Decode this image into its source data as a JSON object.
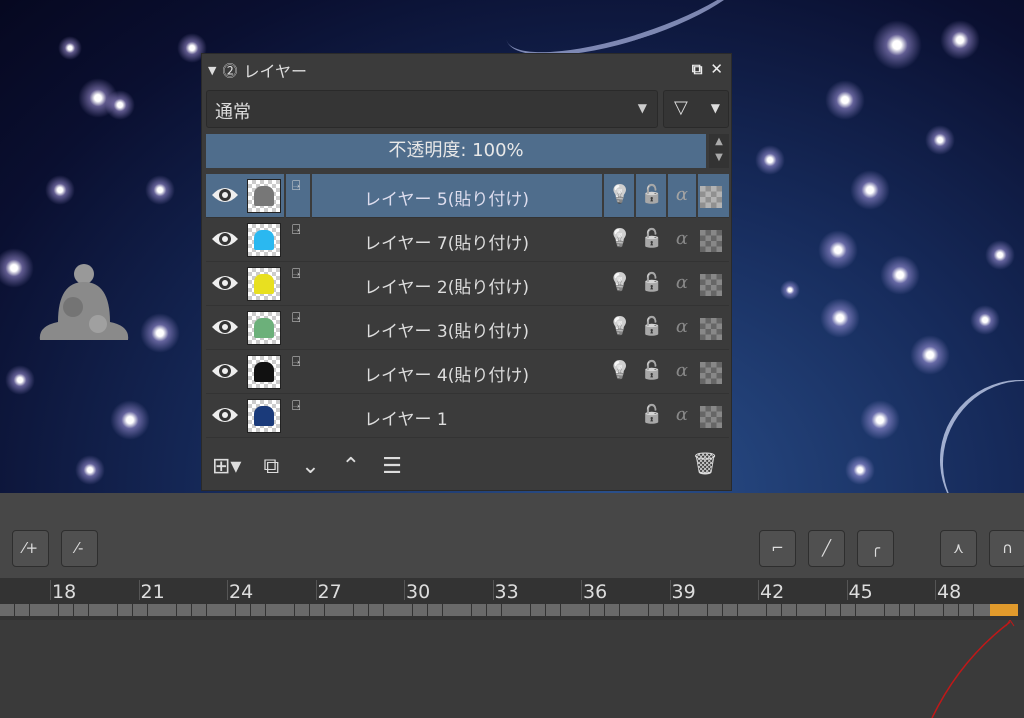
{
  "panel": {
    "title": "レイヤー",
    "blend_mode": "通常",
    "opacity_label": "不透明度: 100%",
    "layers": [
      {
        "name": "レイヤー 5(貼り付け)",
        "selected": true,
        "thumb_color": "#777"
      },
      {
        "name": "レイヤー 7(貼り付け)",
        "selected": false,
        "thumb_color": "#2bb8f0"
      },
      {
        "name": "レイヤー 2(貼り付け)",
        "selected": false,
        "thumb_color": "#e8e020"
      },
      {
        "name": "レイヤー 3(貼り付け)",
        "selected": false,
        "thumb_color": "#6cb07a"
      },
      {
        "name": "レイヤー 4(貼り付け)",
        "selected": false,
        "thumb_color": "#111"
      },
      {
        "name": "レイヤー 1",
        "selected": false,
        "thumb_color": "#1a3a7a"
      }
    ]
  },
  "timeline": {
    "frame_labels": [
      "18",
      "21",
      "24",
      "27",
      "30",
      "33",
      "36",
      "39",
      "42",
      "45",
      "48"
    ],
    "current_frame_color": "#e09a2c"
  },
  "colors": {
    "selection": "#4f6d8c"
  }
}
